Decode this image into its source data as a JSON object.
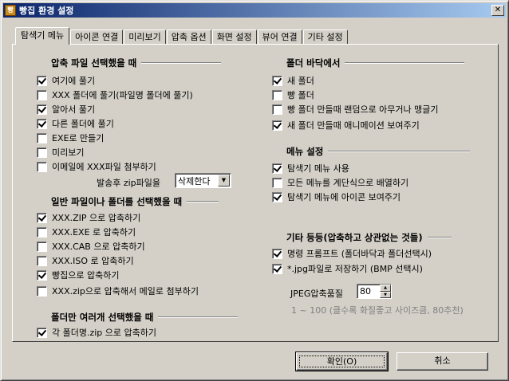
{
  "window": {
    "title": "빵집 환경 설정",
    "icon": "app-icon"
  },
  "tabs": [
    {
      "label": "탐색기 메뉴",
      "active": true
    },
    {
      "label": "아이콘 연결"
    },
    {
      "label": "미리보기"
    },
    {
      "label": "압축 옵션"
    },
    {
      "label": "화면 설정"
    },
    {
      "label": "뷰어 연결"
    },
    {
      "label": "기타 설정"
    }
  ],
  "archive_section": {
    "title": "압축 파일 선택했을 때",
    "items": [
      {
        "label": "여기에 풀기",
        "checked": true
      },
      {
        "label": "XXX 폴더에 풀기(파일명 폴더에 풀기)",
        "checked": false
      },
      {
        "label": "알아서 풀기",
        "checked": true
      },
      {
        "label": "다른 폴더에 풀기",
        "checked": true
      },
      {
        "label": "EXE로 만들기",
        "checked": false
      },
      {
        "label": "미리보기",
        "checked": false
      },
      {
        "label": "이메일에 XXX파일 첨부하기",
        "checked": false
      }
    ],
    "after_send_label": "발송후 zip파일을",
    "after_send_value": "삭제한다"
  },
  "general_section": {
    "title": "일반 파일이나 폴더를 선택했을 때",
    "items": [
      {
        "label": "XXX.ZIP 으로 압축하기",
        "checked": true
      },
      {
        "label": "XXX.EXE 로 압축하기",
        "checked": false
      },
      {
        "label": "XXX.CAB 으로 압축하기",
        "checked": false
      },
      {
        "label": "XXX.ISO 로 압축하기",
        "checked": false
      },
      {
        "label": "빵집으로 압축하기",
        "checked": true
      },
      {
        "label": "XXX.zip으로 압축해서 메일로 첨부하기",
        "checked": false
      }
    ]
  },
  "multi_folder_section": {
    "title": "폴더만 여러개 선택했을 때",
    "items": [
      {
        "label": "각 폴더명.zip 으로 압축하기",
        "checked": true
      }
    ]
  },
  "folder_bg_section": {
    "title": "폴더 바닥에서",
    "items": [
      {
        "label": "새 폴더",
        "checked": true
      },
      {
        "label": "빵 폴더",
        "checked": false
      },
      {
        "label": "빵 폴더 만들때 랜덤으로 아무거나 맹글기",
        "checked": false
      },
      {
        "label": "새 폴더 만들때 애니메이션 보여주기",
        "checked": true
      }
    ]
  },
  "menu_section": {
    "title": "메뉴 설정",
    "items": [
      {
        "label": "탐색기 메뉴 사용",
        "checked": true
      },
      {
        "label": "모든 메뉴를 계단식으로 배열하기",
        "checked": false
      },
      {
        "label": "탐색기 메뉴에 아이콘 보여주기",
        "checked": true
      }
    ]
  },
  "misc_section": {
    "title": "기타 등등(압축하고 상관없는 것들)",
    "items": [
      {
        "label": "명령 프롬프트 (폴더바닥과 폴더선택시)",
        "checked": true
      },
      {
        "label": "*.jpg파일로 저장하기 (BMP 선택시)",
        "checked": true
      }
    ],
    "jpeg_quality_label": "JPEG압축품질",
    "jpeg_quality_value": "80",
    "jpeg_hint": "1 ~ 100 (클수록 화질좋고 사이즈큼, 80추천)"
  },
  "buttons": {
    "ok": "확인(O)",
    "cancel": "취소"
  }
}
